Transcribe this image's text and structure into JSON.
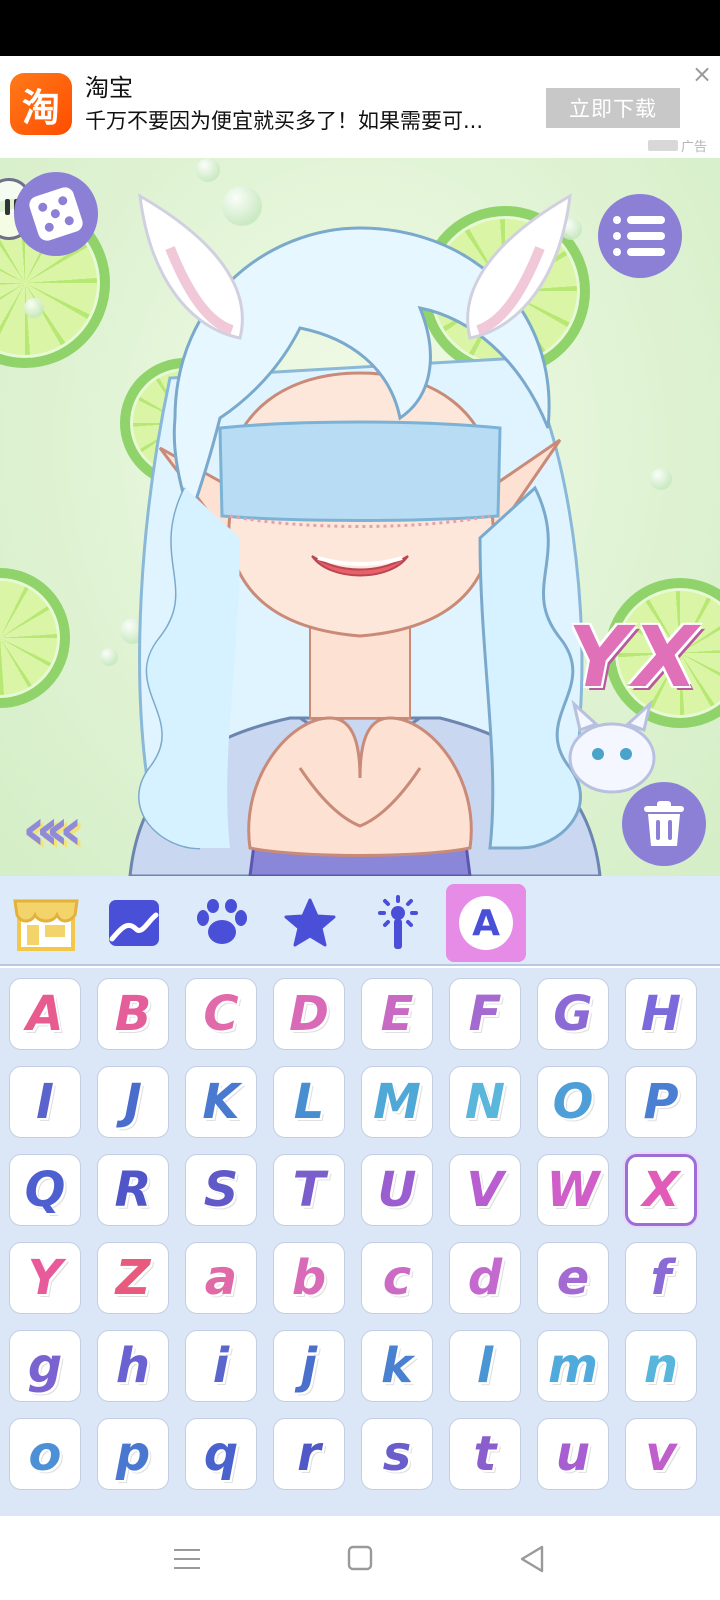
{
  "ad": {
    "app_name": "淘宝",
    "icon_char": "淘",
    "description": "千万不要因为便宜就买多了！如果需要可...",
    "button_label": "立即下载",
    "close_symbol": "×",
    "tag": "广告"
  },
  "scene": {
    "text_sticker": "YX",
    "buttons": {
      "dice": "dice-icon",
      "menu": "menu-list-icon",
      "trash": "trash-icon"
    },
    "back_arrows": "«"
  },
  "palette": {
    "tabs": [
      {
        "icon": "shop-icon"
      },
      {
        "icon": "background-icon"
      },
      {
        "icon": "paw-icon"
      },
      {
        "icon": "star-icon"
      },
      {
        "icon": "magic-wand-icon"
      },
      {
        "icon": "letter-a-icon",
        "label": "A",
        "active": true
      }
    ]
  },
  "letters": {
    "items": [
      {
        "ch": "A",
        "color": "#e85b8e"
      },
      {
        "ch": "B",
        "color": "#e45f9a"
      },
      {
        "ch": "C",
        "color": "#e06aaa"
      },
      {
        "ch": "D",
        "color": "#d96ab8"
      },
      {
        "ch": "E",
        "color": "#c86ac4"
      },
      {
        "ch": "F",
        "color": "#a56ad0"
      },
      {
        "ch": "G",
        "color": "#8c6ad6"
      },
      {
        "ch": "H",
        "color": "#7a6adc"
      },
      {
        "ch": "I",
        "color": "#5a64cc"
      },
      {
        "ch": "J",
        "color": "#4a6ccc"
      },
      {
        "ch": "K",
        "color": "#4a7ad0"
      },
      {
        "ch": "L",
        "color": "#4a8ed2"
      },
      {
        "ch": "M",
        "color": "#50a8d6"
      },
      {
        "ch": "N",
        "color": "#5ab6da"
      },
      {
        "ch": "O",
        "color": "#4e9ed8"
      },
      {
        "ch": "P",
        "color": "#4b7fd2"
      },
      {
        "ch": "Q",
        "color": "#4e5fcf"
      },
      {
        "ch": "R",
        "color": "#5055c8"
      },
      {
        "ch": "S",
        "color": "#5f5ac8"
      },
      {
        "ch": "T",
        "color": "#7a5ecc"
      },
      {
        "ch": "U",
        "color": "#9a5ed0"
      },
      {
        "ch": "V",
        "color": "#b85ed0"
      },
      {
        "ch": "W",
        "color": "#d05ec8"
      },
      {
        "ch": "X",
        "color": "#e05cb8"
      },
      {
        "ch": "Y",
        "color": "#e85a9a"
      },
      {
        "ch": "Z",
        "color": "#e85a7e"
      },
      {
        "ch": "a",
        "color": "#e06aa8"
      },
      {
        "ch": "b",
        "color": "#d86ab8"
      },
      {
        "ch": "c",
        "color": "#cc6ac4"
      },
      {
        "ch": "d",
        "color": "#c46ace"
      },
      {
        "ch": "e",
        "color": "#a46ad4"
      },
      {
        "ch": "f",
        "color": "#8c6ad6"
      },
      {
        "ch": "g",
        "color": "#7a62d0"
      },
      {
        "ch": "h",
        "color": "#6a62d0"
      },
      {
        "ch": "i",
        "color": "#5a66cc"
      },
      {
        "ch": "j",
        "color": "#4a70cc"
      },
      {
        "ch": "k",
        "color": "#4a80d0"
      },
      {
        "ch": "l",
        "color": "#4a96d4"
      },
      {
        "ch": "m",
        "color": "#50aadc"
      },
      {
        "ch": "n",
        "color": "#58b6dc"
      },
      {
        "ch": "o",
        "color": "#4e90d6"
      },
      {
        "ch": "p",
        "color": "#4a78d0"
      },
      {
        "ch": "q",
        "color": "#4a62cc"
      },
      {
        "ch": "r",
        "color": "#5058c8"
      },
      {
        "ch": "s",
        "color": "#6a5ecc"
      },
      {
        "ch": "t",
        "color": "#8a5ecc"
      },
      {
        "ch": "u",
        "color": "#a65ed0"
      },
      {
        "ch": "v",
        "color": "#c05ecc"
      }
    ],
    "selected": "X"
  },
  "navbar": {
    "icons": [
      "menu-nav-icon",
      "home-nav-icon",
      "back-nav-icon"
    ]
  }
}
